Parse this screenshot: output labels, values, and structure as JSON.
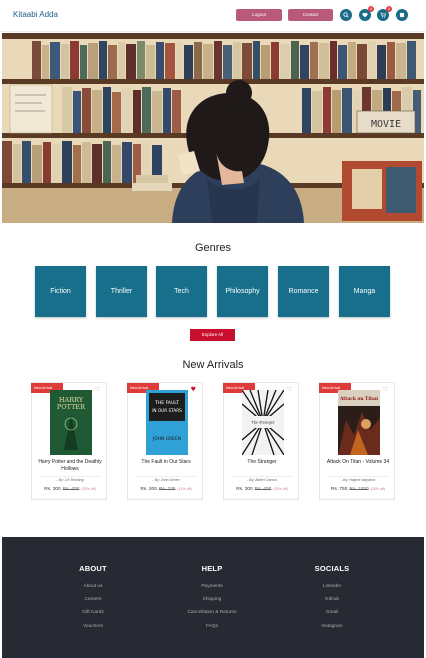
{
  "header": {
    "brand": "Kitaabi Adda",
    "logout_label": "Logout",
    "contact_label": "Contact",
    "icons": [
      "search-icon",
      "heart-icon",
      "cart-icon",
      "user-icon"
    ],
    "wishlist_count": "0",
    "cart_count": "0"
  },
  "hero": {
    "sign_text": "MOVIE"
  },
  "genres": {
    "title": "Genres",
    "items": [
      "Fiction",
      "Thriller",
      "Tech",
      "Philosophy",
      "Romance",
      "Manga"
    ],
    "explore_label": "Explore All"
  },
  "arrivals": {
    "title": "New Arrivals",
    "badge": "New Arrival",
    "books": [
      {
        "title": "Harry Potter and the Deathly Hollows",
        "author": "- By: J.K Rowling",
        "price": "Rs. 300",
        "mrp": "Rs. 400",
        "discount": "(25% off)",
        "wishlisted": false,
        "cover_text": [
          "HARRY",
          "POTTER"
        ]
      },
      {
        "title": "The Fault in Our Stars",
        "author": "- By: John Green",
        "price": "Rs. 200",
        "mrp": "Rs. 225",
        "discount": "(11% off)",
        "wishlisted": true,
        "cover_text": [
          "THE FAULT",
          "IN OUR STARS",
          "JOHN GREEN"
        ]
      },
      {
        "title": "The Stranger",
        "author": "- By: Albert Camus",
        "price": "Rs. 300",
        "mrp": "Rs. 400",
        "discount": "(25% off)",
        "wishlisted": false,
        "cover_text": [
          "The Stranger"
        ]
      },
      {
        "title": "Attack On Titan - Volume 34",
        "author": "- By: Hajime Isayama",
        "price": "Rs. 750",
        "mrp": "Rs. 1000",
        "discount": "(25% off)",
        "wishlisted": false,
        "cover_text": [
          "Attack on Titan"
        ]
      }
    ]
  },
  "footer": {
    "columns": [
      {
        "heading": "ABOUT",
        "links": [
          "About us",
          "Careers",
          "Gift Cards",
          "Vouchers"
        ]
      },
      {
        "heading": "HELP",
        "links": [
          "Payments",
          "Shipping",
          "Cancellation & Returns",
          "FAQs"
        ]
      },
      {
        "heading": "SOCIALS",
        "links": [
          "LinkedIn",
          "Github",
          "Gmail",
          "Instagram"
        ]
      }
    ]
  },
  "colors": {
    "brand": "#1b5f86",
    "genre_tile": "#176f8b",
    "accent_red": "#c8102e",
    "header_pill": "#b85a78",
    "footer_bg": "#282a33"
  }
}
